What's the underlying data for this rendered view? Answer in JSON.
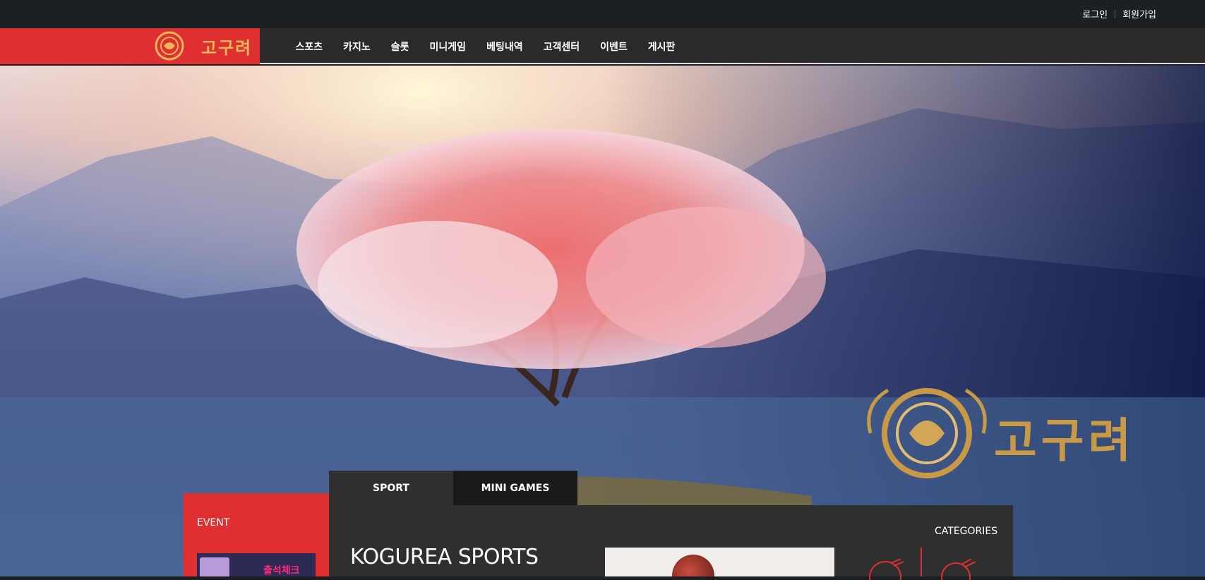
{
  "topbar": {
    "login": "로그인",
    "signup": "회원가입"
  },
  "brand": {
    "name": "고구려",
    "colors": {
      "red": "#de3030",
      "gold": "#c89a45",
      "dark": "#2a2a2a"
    }
  },
  "nav": {
    "items": [
      "스포츠",
      "카지노",
      "슬롯",
      "미니게임",
      "베팅내역",
      "고객센터",
      "이벤트",
      "게시판"
    ]
  },
  "hero": {
    "logo_text": "고구려",
    "logo_icon": "dragon-emblem-icon"
  },
  "event": {
    "title": "EVENT",
    "banner_text": "출석체크",
    "banner_icon": "calendar-icon"
  },
  "tabs": [
    {
      "label": "SPORT",
      "active": true
    },
    {
      "label": "MINI GAMES",
      "active": false
    }
  ],
  "sports": {
    "title": "KOGUREA SPORTS"
  },
  "categories": {
    "title": "CATEGORIES",
    "icons": [
      "soccer-ball-icon",
      "tennis-ball-icon"
    ]
  }
}
